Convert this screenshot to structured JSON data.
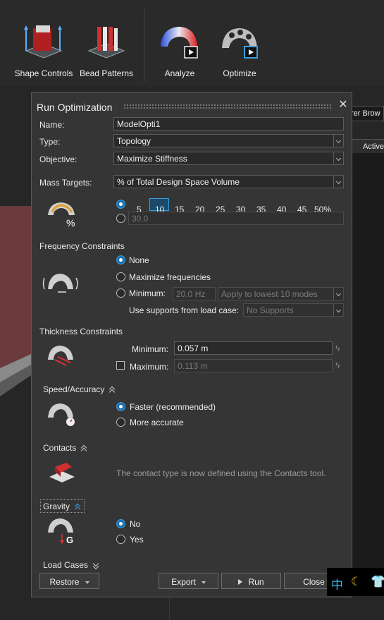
{
  "ribbon": {
    "tools": [
      {
        "label": "Shape Controls",
        "icon": "shape-controls-icon"
      },
      {
        "label": "Bead Patterns",
        "icon": "bead-patterns-icon"
      },
      {
        "label": "Analyze",
        "icon": "analyze-icon"
      },
      {
        "label": "Optimize",
        "icon": "optimize-icon"
      }
    ]
  },
  "browser": {
    "tab_label": "rer Brow",
    "col_header": "Active"
  },
  "dialog": {
    "title": "Run Optimization",
    "name_label": "Name:",
    "name_value": "ModelOpti1",
    "type_label": "Type:",
    "type_value": "Topology",
    "objective_label": "Objective:",
    "objective_value": "Maximize Stiffness",
    "mass_targets_label": "Mass Targets:",
    "mass_targets_value": "% of Total Design Space Volume",
    "mass_options": [
      "5",
      "10",
      "15",
      "20",
      "25",
      "30",
      "35",
      "40",
      "45",
      "50%"
    ],
    "mass_selected": "10",
    "mass_custom_value": "30.0",
    "frequency": {
      "header": "Frequency Constraints",
      "none": "None",
      "maximize": "Maximize frequencies",
      "minimum": "Minimum:",
      "minimum_value": "20.0 Hz",
      "modes_value": "Apply to lowest 10 modes",
      "supports_label": "Use supports from load case:",
      "supports_value": "No Supports"
    },
    "thickness": {
      "header": "Thickness Constraints",
      "minimum_label": "Minimum:",
      "minimum_value": "0.057 m",
      "maximum_label": "Maximum:",
      "maximum_value": "0.113 m"
    },
    "speed": {
      "header": "Speed/Accuracy",
      "faster": "Faster (recommended)",
      "accurate": "More accurate"
    },
    "contacts": {
      "header": "Contacts",
      "note": "The contact type is now defined using the Contacts tool."
    },
    "gravity": {
      "header": "Gravity",
      "no": "No",
      "yes": "Yes",
      "icon_letter": "G"
    },
    "load_cases_header": "Load Cases",
    "buttons": {
      "restore": "Restore",
      "export": "Export",
      "run": "Run",
      "close": "Close"
    }
  },
  "tray": {
    "ime": "中"
  },
  "colors": {
    "accent": "#3aa0e0",
    "background": "#353535"
  }
}
